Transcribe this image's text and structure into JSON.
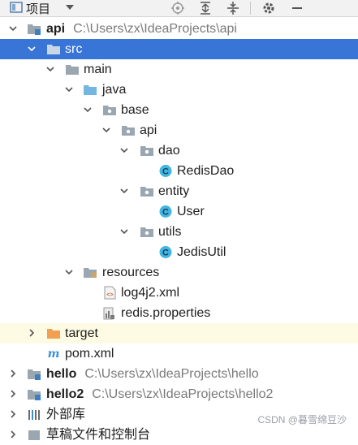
{
  "toolbar": {
    "project_label": "项目",
    "icons": [
      "project-view-icon",
      "dropdown-caret-icon",
      "locate-icon",
      "expand-all-icon",
      "collapse-all-icon",
      "settings-icon",
      "hide-icon"
    ]
  },
  "tree": {
    "api": {
      "label": "api",
      "path": "C:\\Users\\zx\\IdeaProjects\\api"
    },
    "src": {
      "label": "src"
    },
    "main": {
      "label": "main"
    },
    "java": {
      "label": "java"
    },
    "base": {
      "label": "base"
    },
    "pkg_api": {
      "label": "api"
    },
    "dao": {
      "label": "dao"
    },
    "redisdao": {
      "label": "RedisDao"
    },
    "entity": {
      "label": "entity"
    },
    "user": {
      "label": "User"
    },
    "utils": {
      "label": "utils"
    },
    "jedisutil": {
      "label": "JedisUtil"
    },
    "resources": {
      "label": "resources"
    },
    "log4j2": {
      "label": "log4j2.xml"
    },
    "redisprops": {
      "label": "redis.properties"
    },
    "target": {
      "label": "target"
    },
    "pom": {
      "label": "pom.xml"
    },
    "hello": {
      "label": "hello",
      "path": "C:\\Users\\zx\\IdeaProjects\\hello"
    },
    "hello2": {
      "label": "hello2",
      "path": "C:\\Users\\zx\\IdeaProjects\\hello2"
    },
    "libs": {
      "label": "外部库"
    },
    "scratches": {
      "label": "草稿文件和控制台"
    }
  },
  "watermark": "CSDN @暮雪绵豆沙",
  "colors": {
    "selection": "#3875d6",
    "excluded_bg": "#fdfbe4",
    "folder": "#9aa7b0",
    "source_folder": "#73b6e0",
    "class_icon": "#40b6e0",
    "excluded_folder": "#f0a050"
  }
}
